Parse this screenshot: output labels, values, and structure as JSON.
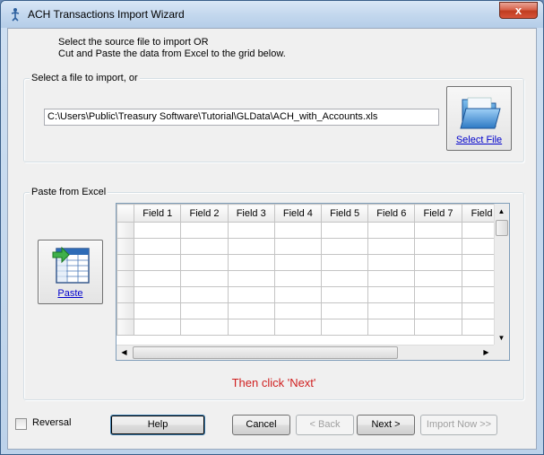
{
  "window": {
    "title": "ACH Transactions Import Wizard",
    "close_glyph": "x"
  },
  "instructions": {
    "line1": "Select the source file to import OR",
    "line2": "Cut and Paste the data from Excel to the grid below."
  },
  "file_group": {
    "label": "Select a file to import, or",
    "path_value": "C:\\Users\\Public\\Treasury Software\\Tutorial\\GLData\\ACH_with_Accounts.xls",
    "select_button_label": "Select File",
    "icon": "folder-icon"
  },
  "paste_group": {
    "label": "Paste from Excel",
    "paste_button_label": "Paste",
    "icon": "paste-grid-icon",
    "grid": {
      "columns": [
        "Field 1",
        "Field 2",
        "Field 3",
        "Field 4",
        "Field 5",
        "Field 6",
        "Field 7",
        "Field"
      ]
    },
    "hint": "Then click 'Next'"
  },
  "footer": {
    "reversal_label": "Reversal",
    "reversal_checked": false,
    "help_label": "Help",
    "cancel_label": "Cancel",
    "back_label": "< Back",
    "next_label": "Next >",
    "import_label": "Import Now >>"
  },
  "colors": {
    "hint_red": "#d02020",
    "link_blue": "#0000cc"
  }
}
